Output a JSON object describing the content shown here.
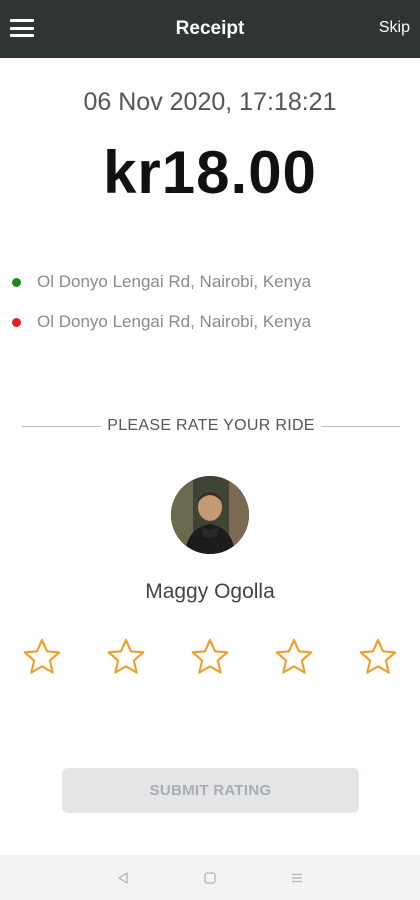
{
  "header": {
    "title": "Receipt",
    "skip_label": "Skip",
    "menu_icon": "hamburger-menu-icon"
  },
  "receipt": {
    "datetime": "06 Nov 2020, 17:18:21",
    "amount": "kr18.00"
  },
  "locations": {
    "pickup": {
      "address": "Ol Donyo Lengai Rd, Nairobi, Kenya",
      "color": "#1a8a1a"
    },
    "dropoff": {
      "address": "Ol Donyo Lengai Rd, Nairobi, Kenya",
      "color": "#e02020"
    }
  },
  "rating": {
    "prompt": "PLEASE RATE YOUR RIDE",
    "driver_name": "Maggy Ogolla",
    "max_stars": 5,
    "selected_stars": 0,
    "star_color": "#f0a030",
    "submit_label": "SUBMIT RATING"
  },
  "colors": {
    "header_bg": "#2f3535",
    "submit_bg": "#e3e5e6",
    "submit_text": "#a8aeb2"
  },
  "navbar": {
    "buttons": [
      "back-icon",
      "home-icon",
      "recents-icon"
    ]
  }
}
